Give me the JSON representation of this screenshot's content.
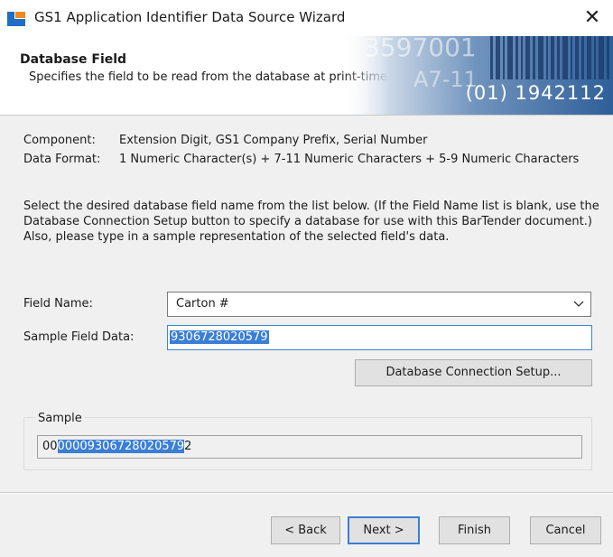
{
  "window": {
    "title": "GS1 Application Identifier Data Source Wizard",
    "close_glyph": "✕"
  },
  "header": {
    "title": "Database Field",
    "subtitle": "Specifies the field to be read from the database at print-time.",
    "banner_text_1": "3597001",
    "banner_text_2": "A7-11",
    "banner_gtin": "(01) 1942112"
  },
  "info": {
    "component_label": "Component:",
    "component_value": "Extension Digit, GS1 Company Prefix, Serial Number",
    "format_label": "Data Format:",
    "format_value": "1 Numeric Character(s) + 7-11 Numeric Characters + 5-9 Numeric Characters"
  },
  "description": {
    "line1": "Select the desired database field name from the list below. (If the Field Name list is blank, use the Database Connection Setup button to specify a database for use with this BarTender document.)",
    "line2": "Also, please type in a sample representation of the selected field's data."
  },
  "form": {
    "field_name_label": "Field Name:",
    "field_name_value": "Carton #",
    "sample_data_label": "Sample Field Data:",
    "sample_data_value": "9306728020579",
    "db_setup_button": "Database Connection Setup..."
  },
  "sample": {
    "group_label": "Sample",
    "prefix": "00",
    "highlighted": "000093067280205792",
    "highlighted_part": "00009306728020579",
    "suffix": "2"
  },
  "footer": {
    "back": "< Back",
    "next": "Next >",
    "finish": "Finish",
    "cancel": "Cancel"
  },
  "colors": {
    "accent": "#3a7fd5",
    "icon_blue": "#1e6fc4",
    "icon_orange": "#f08a1c"
  }
}
